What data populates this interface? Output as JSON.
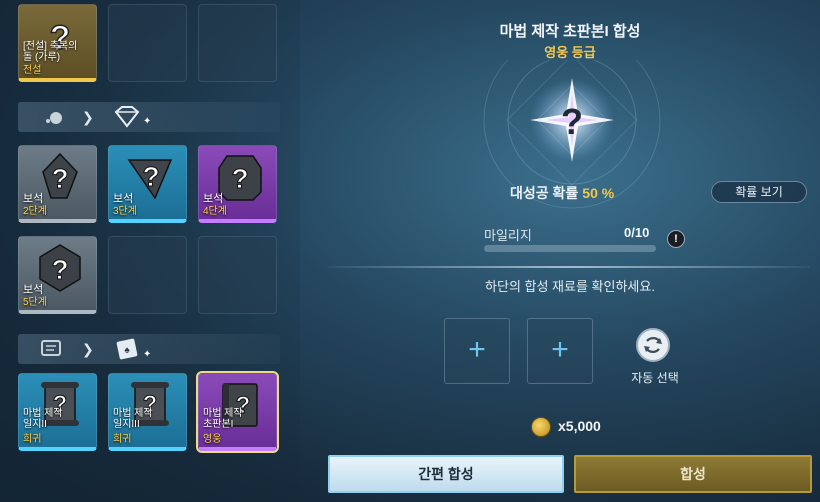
{
  "colors": {
    "gold": "#f3c84c",
    "tier_gray": "#aeb8c0",
    "tier_blue": "#55d3ff",
    "tier_purple": "#c47dff",
    "tier_legend": "#f1c94a"
  },
  "left": {
    "top_items": [
      {
        "name": "[전설] 축복의 돌 (가루)",
        "line1": "[전설] 축복의",
        "line2": "돌 (가루)",
        "tier_label": "전설",
        "rarity": "legend"
      }
    ],
    "gem_section": {
      "icon_from": "gem-dust-icon",
      "icon_to": "diamond-icon"
    },
    "gems": [
      {
        "name": "보석",
        "tier": "2단계",
        "rarity": "gray"
      },
      {
        "name": "보석",
        "tier": "3단계",
        "rarity": "blue"
      },
      {
        "name": "보석",
        "tier": "4단계",
        "rarity": "purple"
      },
      {
        "name": "보석",
        "tier": "5단계",
        "rarity": "gray"
      }
    ],
    "scroll_section": {
      "icon_from": "scroll-icon",
      "icon_to": "card-icon"
    },
    "scrolls": [
      {
        "line1": "마법 제작",
        "line2": "일지II",
        "tier": "희귀",
        "rarity": "blue"
      },
      {
        "line1": "마법 제작",
        "line2": "일지III",
        "tier": "희귀",
        "rarity": "blue"
      },
      {
        "line1": "마법 제작",
        "line2": "초판본I",
        "tier": "영웅",
        "rarity": "purple"
      }
    ]
  },
  "main": {
    "title": "마법 제작 초판본I 합성",
    "grade": "영웅 등급",
    "success_label": "대성공 확률",
    "success_pct": "50 %",
    "prob_button": "확률 보기",
    "mileage_label": "마일리지",
    "mileage_value": "0/10",
    "mileage_fraction": 0,
    "hint": "하단의 합성 재료를 확인하세요.",
    "auto_label": "자동 선택",
    "cost": "x5,000",
    "quick_button": "간편 합성",
    "synth_button": "합성"
  }
}
